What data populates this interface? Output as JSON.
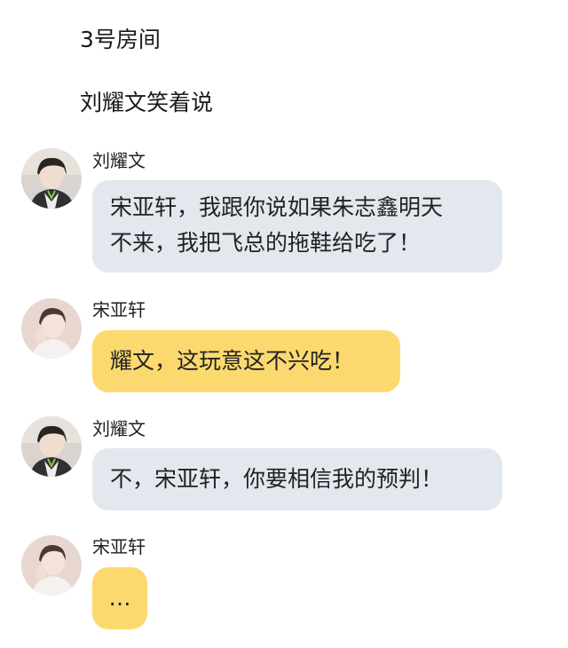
{
  "header": {
    "room_title": "3号房间",
    "subtitle": "刘耀文笑着说"
  },
  "messages": [
    {
      "sender": "刘耀文",
      "text": "宋亚轩，我跟你说如果朱志鑫明天不来，我把飞总的拖鞋给吃了！",
      "line1": "宋亚轩，我跟你说如果朱志鑫明天",
      "line2": "不来，我把飞总的拖鞋给吃了！",
      "bubble_color": "#e3e7ee",
      "avatar": "avatar-liu"
    },
    {
      "sender": "宋亚轩",
      "text": "耀文，这玩意这不兴吃！",
      "bubble_color": "#fcd96e",
      "avatar": "avatar-song"
    },
    {
      "sender": "刘耀文",
      "text": "不，宋亚轩，你要相信我的预判！",
      "bubble_color": "#e3e7ee",
      "avatar": "avatar-liu"
    },
    {
      "sender": "宋亚轩",
      "text": "…",
      "bubble_color": "#fcd96e",
      "avatar": "avatar-song"
    }
  ]
}
